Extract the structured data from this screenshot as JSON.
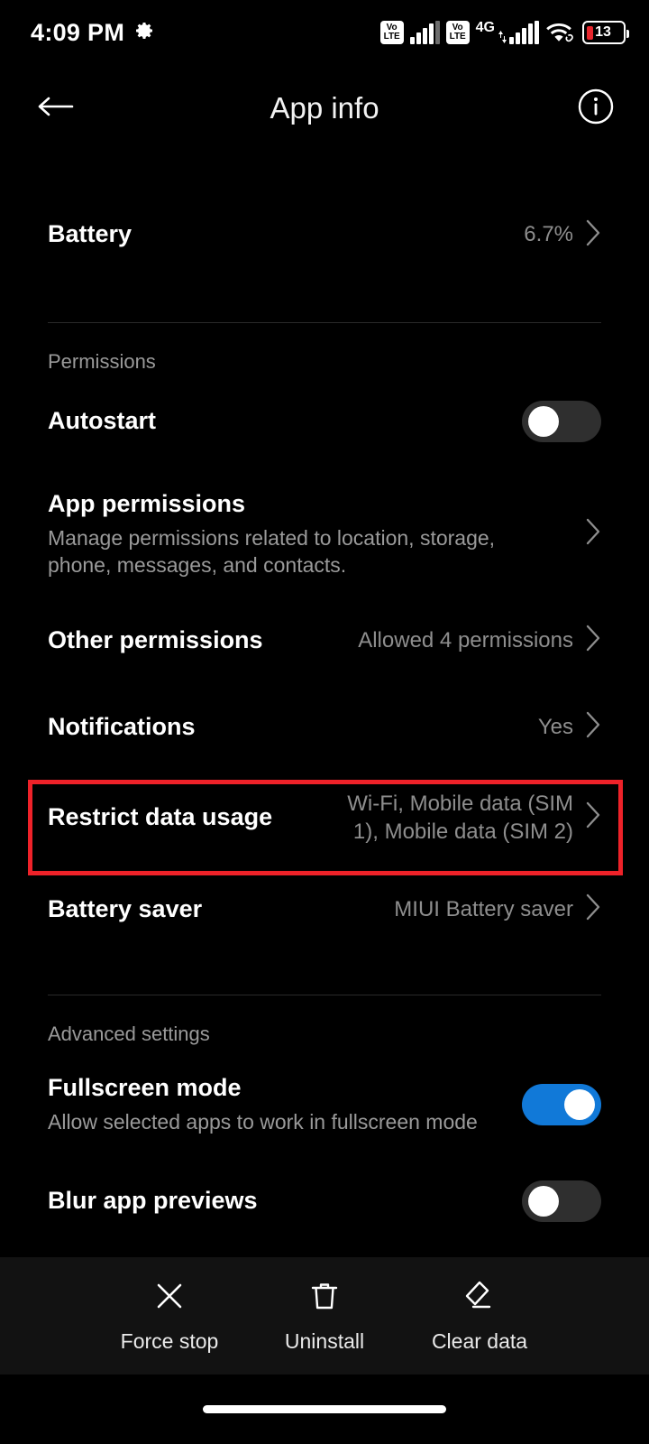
{
  "status_bar": {
    "time": "4:09 PM",
    "gear_icon": "gear-icon",
    "volte_badge_top": "Vo",
    "volte_badge_bottom": "LTE",
    "network_label": "4G",
    "wifi_icon": "wifi-icon",
    "battery_percent": "13"
  },
  "appbar": {
    "back_icon": "back-arrow-icon",
    "title": "App info",
    "info_icon": "info-icon"
  },
  "battery_row": {
    "title": "Battery",
    "value": "6.7%"
  },
  "sections": {
    "permissions_label": "Permissions",
    "advanced_label": "Advanced settings"
  },
  "rows": {
    "autostart": {
      "title": "Autostart",
      "toggle_state": "off"
    },
    "app_permissions": {
      "title": "App permissions",
      "subtitle": "Manage permissions related to location, storage, phone, messages, and contacts."
    },
    "other_permissions": {
      "title": "Other permissions",
      "value": "Allowed 4 permissions"
    },
    "notifications": {
      "title": "Notifications",
      "value": "Yes"
    },
    "restrict_data_usage": {
      "title": "Restrict data usage",
      "value": "Wi-Fi, Mobile data (SIM 1), Mobile data (SIM 2)",
      "highlighted": true,
      "highlight_color": "#ee2229"
    },
    "battery_saver": {
      "title": "Battery saver",
      "value": "MIUI Battery saver"
    },
    "fullscreen_mode": {
      "title": "Fullscreen mode",
      "subtitle": "Allow selected apps to work in fullscreen mode",
      "toggle_state": "on"
    },
    "blur_app_previews": {
      "title": "Blur app previews",
      "toggle_state": "off"
    }
  },
  "bottom_bar": {
    "actions": [
      {
        "label": "Force stop",
        "icon": "close-x-icon"
      },
      {
        "label": "Uninstall",
        "icon": "trash-icon"
      },
      {
        "label": "Clear data",
        "icon": "eraser-icon"
      }
    ]
  },
  "colors": {
    "background": "#000000",
    "accent_blue": "#1179d8",
    "highlight_red": "#ee2229",
    "secondary_text": "#9a9a9a"
  }
}
